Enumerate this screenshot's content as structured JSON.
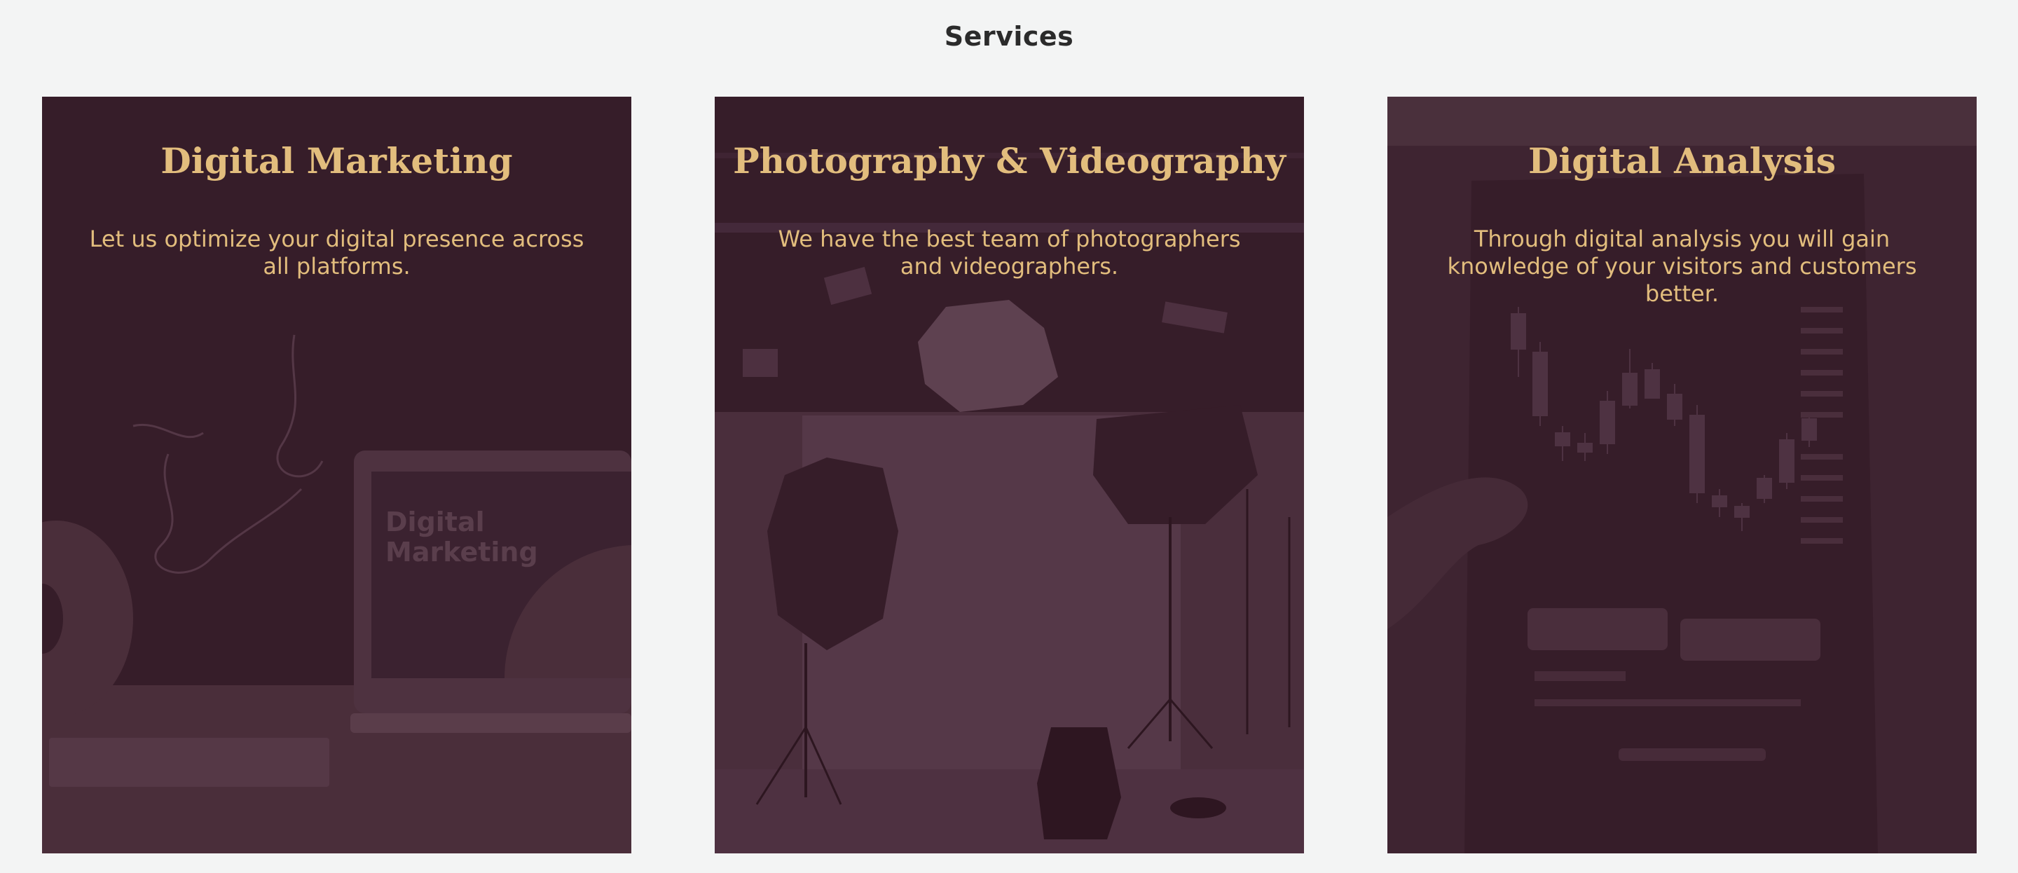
{
  "section": {
    "title": "Services"
  },
  "colors": {
    "accent": "#e2bd7d",
    "card": "#361d29",
    "page": "#f3f4f4"
  },
  "cards": [
    {
      "title": "Digital Marketing",
      "text": "Let us optimize your digital presence across all platforms.",
      "image_text": [
        "Digital",
        "Marketing"
      ]
    },
    {
      "title": "Photography & Videography",
      "text": "We have the best team of photographers and videographers."
    },
    {
      "title": "Digital Analysis",
      "text": "Through digital analysis you will gain knowledge of your visitors and customers better."
    }
  ]
}
